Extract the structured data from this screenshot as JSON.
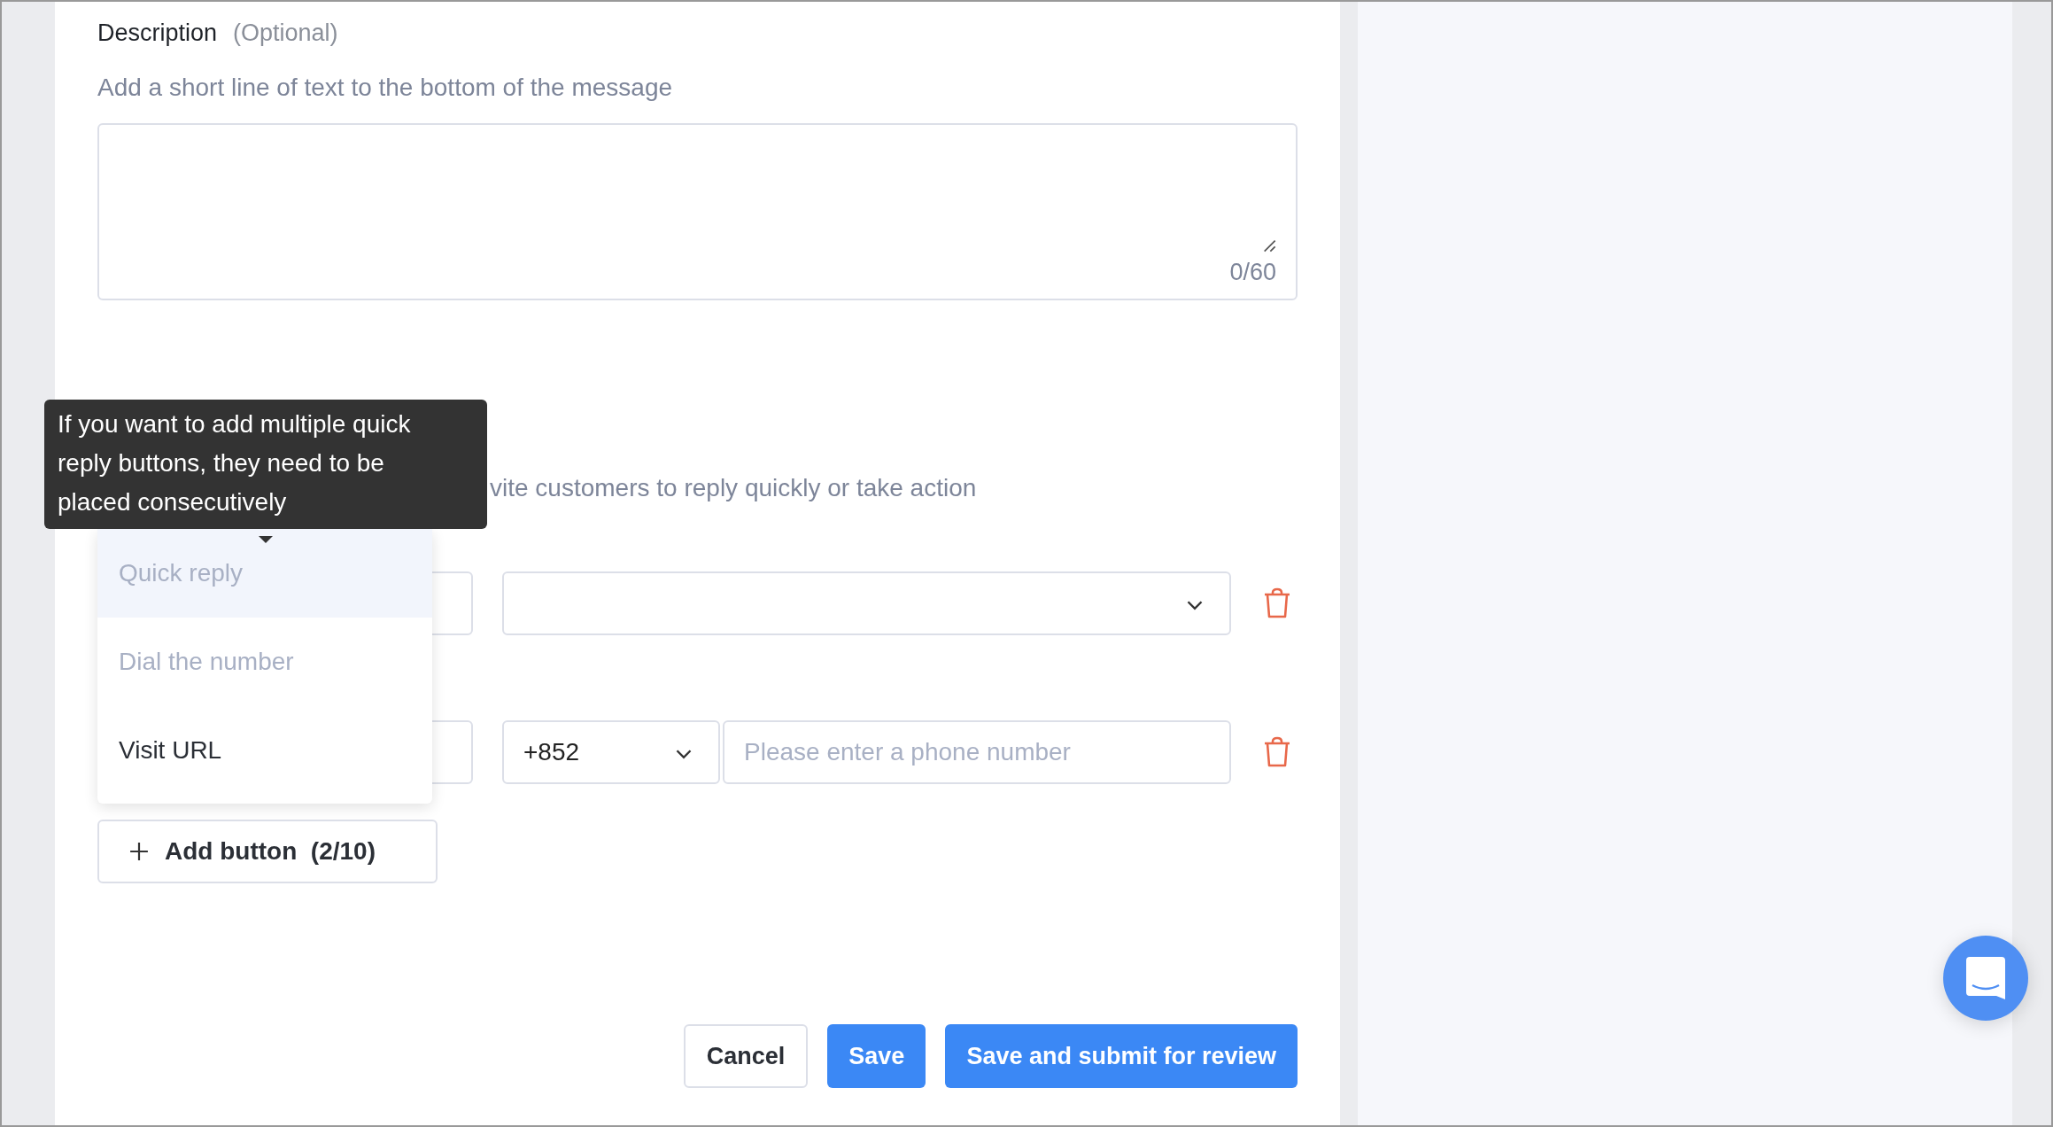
{
  "description": {
    "label": "Description",
    "optional": "(Optional)",
    "hint": "Add a short line of text to the bottom of the message",
    "counter": "0/60"
  },
  "buttons_section": {
    "hint": "vite customers to reply quickly or take action"
  },
  "button_rows": [
    {
      "kind": "select"
    },
    {
      "kind": "phone",
      "country": "+852",
      "placeholder": "Please enter a phone number"
    }
  ],
  "type_menu": {
    "options": [
      {
        "label": "Quick reply",
        "selected": true,
        "disabled": true
      },
      {
        "label": "Dial the number",
        "selected": false,
        "disabled": true
      },
      {
        "label": "Visit URL",
        "selected": false,
        "disabled": false
      }
    ]
  },
  "tooltip": "If you want to add multiple quick reply buttons, they need to be placed consecutively",
  "add_button": {
    "label": "Add button",
    "count": "(2/10)"
  },
  "footer": {
    "cancel": "Cancel",
    "save": "Save",
    "submit": "Save and submit for review"
  }
}
